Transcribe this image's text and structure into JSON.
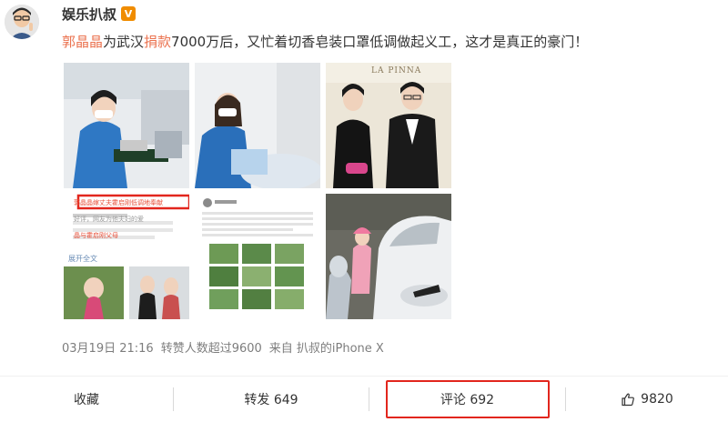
{
  "post": {
    "username": "娱乐扒叔",
    "verified_badge": "V",
    "text_segments": [
      {
        "text": "郭晶晶",
        "highlight": true
      },
      {
        "text": "为武汉",
        "highlight": false
      },
      {
        "text": "捐款",
        "highlight": true
      },
      {
        "text": "7000万后，又忙着切香皂装口罩低调做起义工，这才是真正的豪门！",
        "highlight": false
      }
    ],
    "meta": {
      "date": "03月19日 21:16",
      "reposts": "转赞人数超过9600",
      "source": "来自 扒叔的iPhone X"
    }
  },
  "images": {
    "overlay_snippet_1": "郭晶晶嫁丈夫霍启刚低调地奉献",
    "overlay_snippet_2": "好评，网友为他夫妇的爱",
    "overlay_snippet_3": "晶与霍启刚父母",
    "overlay_expand": "展开全文",
    "banner_text": "LA PINNA"
  },
  "actions": {
    "favorite": "收藏",
    "repost": "转发 649",
    "comment": "评论 692",
    "like": "9820"
  },
  "colors": {
    "highlight": "#eb7350",
    "badge": "#f08c00",
    "annotation_box": "#e2261d"
  }
}
